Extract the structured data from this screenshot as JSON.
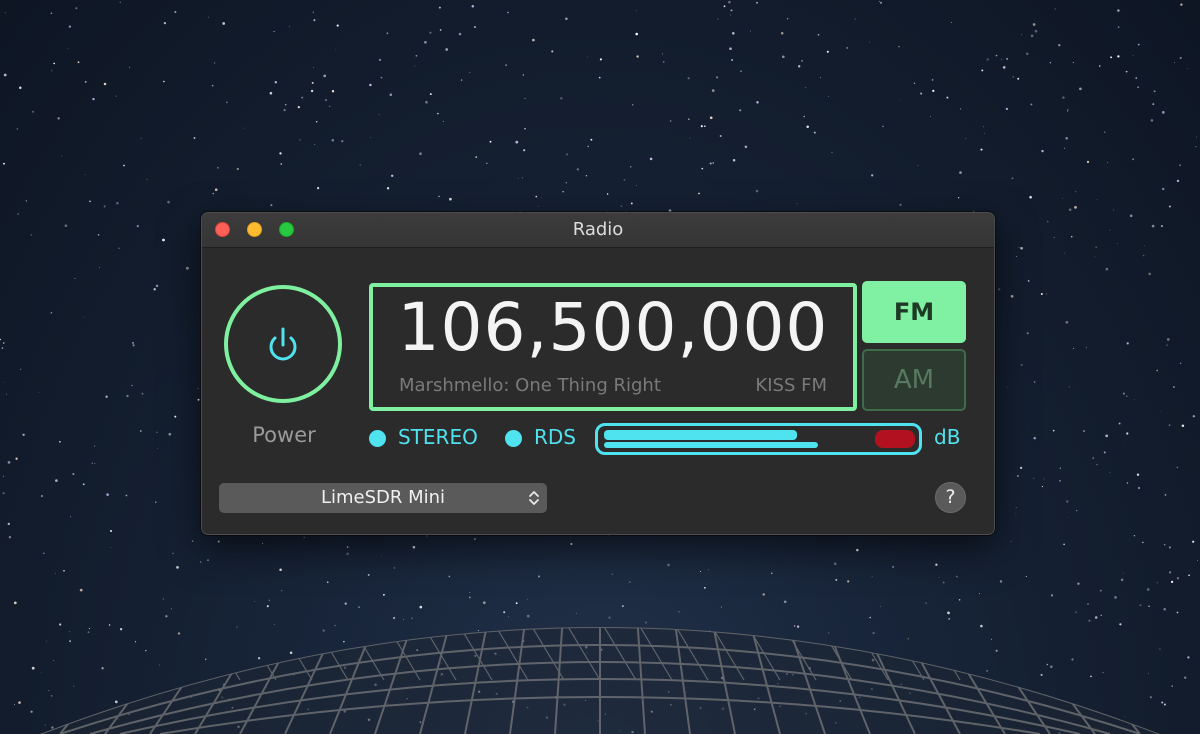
{
  "window": {
    "title": "Radio"
  },
  "power": {
    "label": "Power",
    "icon": "power-icon"
  },
  "display": {
    "frequency": "106,500,000",
    "rds_text": "Marshmello: One Thing Right",
    "station_name": "KISS FM"
  },
  "band": {
    "fm_label": "FM",
    "am_label": "AM",
    "selected": "FM"
  },
  "indicators": {
    "stereo_label": "STEREO",
    "rds_label": "RDS"
  },
  "signal_meter": {
    "unit_label": "dB",
    "level_top_fraction": 0.74,
    "level_bottom_fraction": 0.82,
    "peak_color": "#b2121f"
  },
  "device": {
    "selected": "LimeSDR Mini"
  },
  "help": {
    "label": "?"
  },
  "colors": {
    "accent_green": "#7ef0a0",
    "accent_cyan": "#4fe3ef",
    "window_bg": "#2b2b2b"
  }
}
